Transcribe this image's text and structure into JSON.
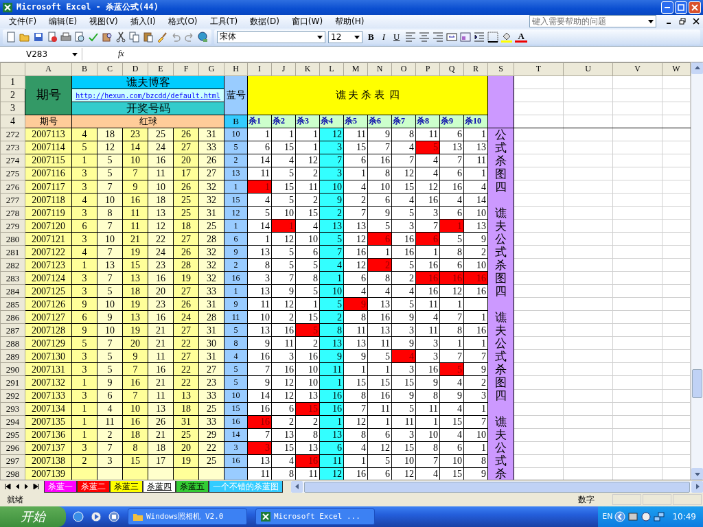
{
  "window": {
    "title": "Microsoft Excel - 杀蓝公式(44)"
  },
  "menu": [
    "文件(F)",
    "编辑(E)",
    "视图(V)",
    "插入(I)",
    "格式(O)",
    "工具(T)",
    "数据(D)",
    "窗口(W)",
    "帮助(H)"
  ],
  "help_search": {
    "placeholder": "键入需要帮助的问题"
  },
  "format_bar": {
    "font": "宋体",
    "size": "12",
    "bold": "B",
    "italic": "I",
    "underline": "U",
    "font_color": "A"
  },
  "formula_bar": {
    "name_box": "V283",
    "fx": "fx"
  },
  "columns": [
    "A",
    "B",
    "C",
    "D",
    "E",
    "F",
    "G",
    "H",
    "I",
    "J",
    "K",
    "L",
    "M",
    "N",
    "O",
    "P",
    "Q",
    "R",
    "S",
    "T",
    "U",
    "V",
    "W"
  ],
  "header": {
    "row_numbers": [
      "1",
      "2",
      "3",
      "4"
    ],
    "period_label": "期号",
    "blog_title": "谯夫博客",
    "url": "http://hexun.com/bzcdd/default.html",
    "draw_label": "开奖号码",
    "blue_label": "蓝号",
    "banner": "谯 夫 杀 表  四",
    "period_sub": "期号",
    "red_label": "红球",
    "blue_sub": "B",
    "kill_labels": [
      "杀1",
      "杀2",
      "杀3",
      "杀4",
      "杀5",
      "杀6",
      "杀7",
      "杀8",
      "杀9",
      "杀10"
    ]
  },
  "side_notes": [
    "公式杀图四",
    "谯夫公式杀图四",
    "谯夫公式杀图四",
    "谯夫公式杀"
  ],
  "rows": [
    {
      "n": "272",
      "period": "2007113",
      "red": [
        "4",
        "18",
        "23",
        "25",
        "26",
        "31"
      ],
      "blue": "10",
      "kills": [
        "1",
        "1",
        "1",
        "12",
        "11",
        "9",
        "8",
        "11",
        "6",
        "1"
      ],
      "hits": [
        false,
        false,
        false,
        false,
        false,
        false,
        false,
        false,
        false,
        false
      ]
    },
    {
      "n": "273",
      "period": "2007114",
      "red": [
        "5",
        "12",
        "14",
        "24",
        "27",
        "33"
      ],
      "blue": "5",
      "kills": [
        "6",
        "15",
        "1",
        "3",
        "15",
        "7",
        "4",
        "5",
        "13",
        "13"
      ],
      "hits": [
        false,
        false,
        false,
        false,
        false,
        false,
        false,
        true,
        false,
        false
      ]
    },
    {
      "n": "274",
      "period": "2007115",
      "red": [
        "1",
        "5",
        "10",
        "16",
        "20",
        "26"
      ],
      "blue": "2",
      "kills": [
        "14",
        "4",
        "12",
        "7",
        "6",
        "16",
        "7",
        "4",
        "7",
        "11"
      ],
      "hits": [
        false,
        false,
        false,
        false,
        false,
        false,
        false,
        false,
        false,
        false
      ]
    },
    {
      "n": "275",
      "period": "2007116",
      "red": [
        "3",
        "5",
        "7",
        "11",
        "17",
        "27"
      ],
      "blue": "13",
      "kills": [
        "11",
        "5",
        "2",
        "3",
        "1",
        "8",
        "12",
        "4",
        "6",
        "1"
      ],
      "hits": [
        false,
        false,
        false,
        false,
        false,
        false,
        false,
        false,
        false,
        false
      ]
    },
    {
      "n": "276",
      "period": "2007117",
      "red": [
        "3",
        "7",
        "9",
        "10",
        "26",
        "32"
      ],
      "blue": "1",
      "kills": [
        "1",
        "15",
        "11",
        "10",
        "4",
        "10",
        "15",
        "12",
        "16",
        "4"
      ],
      "hits": [
        true,
        false,
        false,
        false,
        false,
        false,
        false,
        false,
        false,
        false
      ]
    },
    {
      "n": "277",
      "period": "2007118",
      "red": [
        "4",
        "10",
        "16",
        "18",
        "25",
        "32"
      ],
      "blue": "15",
      "kills": [
        "4",
        "5",
        "2",
        "9",
        "2",
        "6",
        "4",
        "16",
        "4",
        "14"
      ],
      "hits": [
        false,
        false,
        false,
        false,
        false,
        false,
        false,
        false,
        false,
        false
      ]
    },
    {
      "n": "278",
      "period": "2007119",
      "red": [
        "3",
        "8",
        "11",
        "13",
        "25",
        "31"
      ],
      "blue": "12",
      "kills": [
        "5",
        "10",
        "15",
        "2",
        "7",
        "9",
        "5",
        "3",
        "6",
        "10"
      ],
      "hits": [
        false,
        false,
        false,
        false,
        false,
        false,
        false,
        false,
        false,
        false
      ]
    },
    {
      "n": "279",
      "period": "2007120",
      "red": [
        "6",
        "7",
        "11",
        "12",
        "18",
        "25"
      ],
      "blue": "1",
      "kills": [
        "14",
        "1",
        "4",
        "13",
        "13",
        "5",
        "3",
        "7",
        "1",
        "13"
      ],
      "hits": [
        false,
        true,
        false,
        false,
        false,
        false,
        false,
        false,
        true,
        false
      ]
    },
    {
      "n": "280",
      "period": "2007121",
      "red": [
        "3",
        "10",
        "21",
        "22",
        "27",
        "28"
      ],
      "blue": "6",
      "kills": [
        "1",
        "12",
        "10",
        "5",
        "12",
        "6",
        "16",
        "6",
        "5",
        "9"
      ],
      "hits": [
        false,
        false,
        false,
        false,
        false,
        true,
        false,
        true,
        false,
        false
      ]
    },
    {
      "n": "281",
      "period": "2007122",
      "red": [
        "4",
        "7",
        "19",
        "24",
        "26",
        "32"
      ],
      "blue": "9",
      "kills": [
        "13",
        "5",
        "6",
        "7",
        "16",
        "1",
        "16",
        "1",
        "8",
        "2"
      ],
      "hits": [
        false,
        false,
        false,
        false,
        false,
        false,
        false,
        false,
        false,
        false
      ]
    },
    {
      "n": "282",
      "period": "2007123",
      "red": [
        "1",
        "13",
        "15",
        "23",
        "28",
        "32"
      ],
      "blue": "2",
      "kills": [
        "8",
        "5",
        "5",
        "4",
        "12",
        "2",
        "5",
        "16",
        "6",
        "10"
      ],
      "hits": [
        false,
        false,
        false,
        false,
        false,
        true,
        false,
        false,
        false,
        false
      ]
    },
    {
      "n": "283",
      "period": "2007124",
      "red": [
        "3",
        "7",
        "13",
        "16",
        "19",
        "32"
      ],
      "blue": "16",
      "kills": [
        "3",
        "7",
        "8",
        "1",
        "6",
        "8",
        "2",
        "16",
        "16",
        "16"
      ],
      "hits": [
        false,
        false,
        false,
        false,
        false,
        false,
        false,
        true,
        true,
        true
      ]
    },
    {
      "n": "284",
      "period": "2007125",
      "red": [
        "3",
        "5",
        "18",
        "20",
        "27",
        "33"
      ],
      "blue": "1",
      "kills": [
        "13",
        "9",
        "5",
        "10",
        "4",
        "4",
        "4",
        "16",
        "12",
        "16"
      ],
      "hits": [
        false,
        false,
        false,
        false,
        false,
        false,
        false,
        false,
        false,
        false
      ]
    },
    {
      "n": "285",
      "period": "2007126",
      "red": [
        "9",
        "10",
        "19",
        "23",
        "26",
        "31"
      ],
      "blue": "9",
      "kills": [
        "11",
        "12",
        "1",
        "5",
        "9",
        "13",
        "5",
        "11",
        "1"
      ],
      "hits": [
        false,
        false,
        false,
        false,
        true,
        false,
        false,
        false,
        false,
        false
      ]
    },
    {
      "n": "286",
      "period": "2007127",
      "red": [
        "6",
        "9",
        "13",
        "16",
        "24",
        "28"
      ],
      "blue": "11",
      "kills": [
        "10",
        "2",
        "15",
        "2",
        "8",
        "16",
        "9",
        "4",
        "7",
        "1"
      ],
      "hits": [
        false,
        false,
        false,
        false,
        false,
        false,
        false,
        false,
        false,
        false
      ]
    },
    {
      "n": "287",
      "period": "2007128",
      "red": [
        "9",
        "10",
        "19",
        "21",
        "27",
        "31"
      ],
      "blue": "5",
      "kills": [
        "13",
        "16",
        "5",
        "8",
        "11",
        "13",
        "3",
        "11",
        "8",
        "16"
      ],
      "hits": [
        false,
        false,
        true,
        false,
        false,
        false,
        false,
        false,
        false,
        false
      ]
    },
    {
      "n": "288",
      "period": "2007129",
      "red": [
        "5",
        "7",
        "20",
        "21",
        "22",
        "30"
      ],
      "blue": "8",
      "kills": [
        "9",
        "11",
        "2",
        "13",
        "13",
        "11",
        "9",
        "3",
        "1",
        "1"
      ],
      "hits": [
        false,
        false,
        false,
        false,
        false,
        false,
        false,
        false,
        false,
        false
      ]
    },
    {
      "n": "289",
      "period": "2007130",
      "red": [
        "3",
        "5",
        "9",
        "11",
        "27",
        "31"
      ],
      "blue": "4",
      "kills": [
        "16",
        "3",
        "16",
        "9",
        "9",
        "5",
        "4",
        "3",
        "7",
        "7"
      ],
      "hits": [
        false,
        false,
        false,
        false,
        false,
        false,
        true,
        false,
        false,
        false
      ]
    },
    {
      "n": "290",
      "period": "2007131",
      "red": [
        "3",
        "5",
        "7",
        "16",
        "22",
        "27"
      ],
      "blue": "5",
      "kills": [
        "7",
        "16",
        "10",
        "11",
        "1",
        "1",
        "3",
        "16",
        "5",
        "9"
      ],
      "hits": [
        false,
        false,
        false,
        false,
        false,
        false,
        false,
        false,
        true,
        false
      ]
    },
    {
      "n": "291",
      "period": "2007132",
      "red": [
        "1",
        "9",
        "16",
        "21",
        "22",
        "23"
      ],
      "blue": "5",
      "kills": [
        "9",
        "12",
        "10",
        "1",
        "15",
        "15",
        "15",
        "9",
        "4",
        "2"
      ],
      "hits": [
        false,
        false,
        false,
        false,
        false,
        false,
        false,
        false,
        false,
        false
      ]
    },
    {
      "n": "292",
      "period": "2007133",
      "red": [
        "3",
        "6",
        "7",
        "11",
        "13",
        "33"
      ],
      "blue": "10",
      "kills": [
        "14",
        "12",
        "13",
        "16",
        "8",
        "16",
        "9",
        "8",
        "9",
        "3"
      ],
      "hits": [
        false,
        false,
        false,
        false,
        false,
        false,
        false,
        false,
        false,
        false
      ]
    },
    {
      "n": "293",
      "period": "2007134",
      "red": [
        "1",
        "4",
        "10",
        "13",
        "18",
        "25"
      ],
      "blue": "15",
      "kills": [
        "16",
        "6",
        "15",
        "16",
        "7",
        "11",
        "5",
        "11",
        "4",
        "1"
      ],
      "hits": [
        false,
        false,
        true,
        false,
        false,
        false,
        false,
        false,
        false,
        false
      ]
    },
    {
      "n": "294",
      "period": "2007135",
      "red": [
        "1",
        "11",
        "16",
        "26",
        "31",
        "33"
      ],
      "blue": "16",
      "kills": [
        "16",
        "2",
        "2",
        "1",
        "12",
        "1",
        "11",
        "1",
        "15",
        "7"
      ],
      "hits": [
        true,
        false,
        false,
        false,
        false,
        false,
        false,
        false,
        false,
        false
      ]
    },
    {
      "n": "295",
      "period": "2007136",
      "red": [
        "1",
        "2",
        "18",
        "21",
        "25",
        "29"
      ],
      "blue": "14",
      "kills": [
        "7",
        "13",
        "8",
        "13",
        "8",
        "6",
        "3",
        "10",
        "4",
        "10"
      ],
      "hits": [
        false,
        false,
        false,
        false,
        false,
        false,
        false,
        false,
        false,
        false
      ]
    },
    {
      "n": "296",
      "period": "2007137",
      "red": [
        "3",
        "7",
        "8",
        "18",
        "20",
        "22"
      ],
      "blue": "3",
      "kills": [
        "3",
        "15",
        "13",
        "6",
        "4",
        "12",
        "15",
        "8",
        "6",
        "1"
      ],
      "hits": [
        true,
        false,
        false,
        false,
        false,
        false,
        false,
        false,
        false,
        false
      ]
    },
    {
      "n": "297",
      "period": "2007138",
      "red": [
        "2",
        "3",
        "15",
        "17",
        "19",
        "25"
      ],
      "blue": "16",
      "kills": [
        "13",
        "4",
        "16",
        "11",
        "1",
        "5",
        "10",
        "7",
        "10",
        "8"
      ],
      "hits": [
        false,
        false,
        true,
        false,
        false,
        false,
        false,
        false,
        false,
        false
      ]
    },
    {
      "n": "298",
      "period": "2007139",
      "red": [],
      "kills": [
        "11",
        "8",
        "11",
        "12",
        "16",
        "6",
        "12",
        "4",
        "15",
        "9"
      ],
      "hits": [
        false,
        false,
        false,
        false,
        false,
        false,
        false,
        false,
        false,
        false
      ]
    }
  ],
  "sheet_tabs": [
    {
      "label": "杀蓝一",
      "color": "#ff00ff",
      "selected": false
    },
    {
      "label": "杀蓝二",
      "color": "#ff0000",
      "selected": false
    },
    {
      "label": "杀蓝三",
      "color": "#ffff00",
      "selected": false
    },
    {
      "label": "杀蓝四",
      "selected": true
    },
    {
      "label": "杀蓝五",
      "color": "#33cc33",
      "selected": false
    },
    {
      "label": "一个不错的杀蓝图",
      "color": "#33ccff",
      "selected": false
    }
  ],
  "status_bar": {
    "status": "就绪",
    "mode": "数字"
  },
  "taskbar": {
    "start": "开始",
    "tasks": [
      "Windows照相机 V2.0",
      "Microsoft Excel ..."
    ],
    "language": "EN",
    "time": "10:49"
  }
}
